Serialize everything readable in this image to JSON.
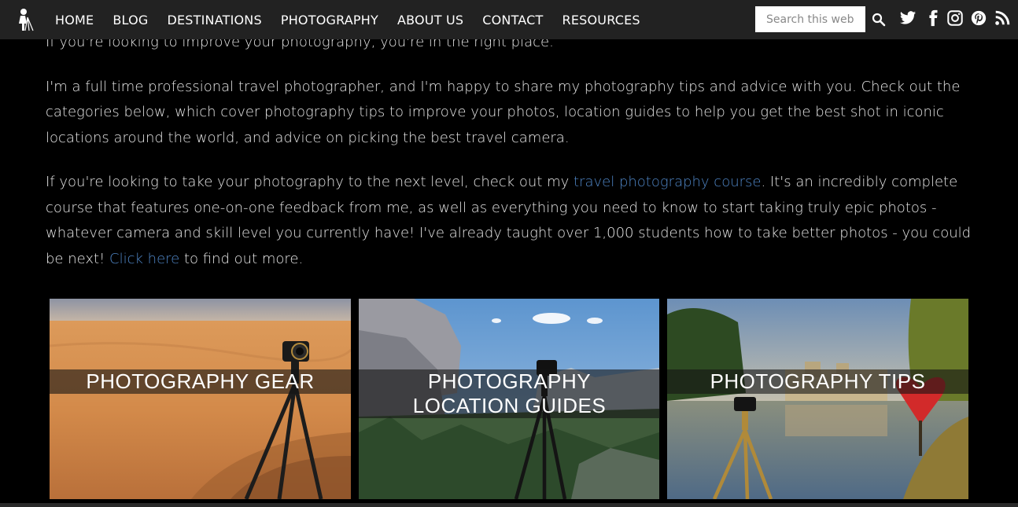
{
  "nav": {
    "items": [
      "HOME",
      "BLOG",
      "DESTINATIONS",
      "PHOTOGRAPHY",
      "ABOUT US",
      "CONTACT",
      "RESOURCES"
    ],
    "search_placeholder": "Search this website"
  },
  "content": {
    "intro": "If you're looking to improve your photography, you're in the right place.",
    "p2": "I'm a full time professional travel photographer, and I'm happy to share my photography tips and advice with you. Check out the categories below, which cover photography tips to improve your photos, location guides to help you get the best shot in iconic locations around the world, and advice on picking the best travel camera.",
    "p3_a": "If you're looking to take your photography to the next level, check out my ",
    "p3_link1": "travel photography course",
    "p3_b": ". It's an incredibly complete course that features one-on-one feedback from me, as well as everything you need to know to start taking truly epic photos - whatever camera and skill level you currently have! I've already taught over 1,000 students how to take better photos - you could be next! ",
    "p3_link2": "Click here",
    "p3_c": " to find out more."
  },
  "tiles": [
    {
      "line1": "PHOTOGRAPHY GEAR",
      "line2": ""
    },
    {
      "line1": "PHOTOGRAPHY",
      "line2": "LOCATION GUIDES"
    },
    {
      "line1": "PHOTOGRAPHY TIPS",
      "line2": ""
    }
  ],
  "colors": {
    "nav_bg": "#222222",
    "page_bg": "#000000",
    "link": "#4f86c6"
  }
}
